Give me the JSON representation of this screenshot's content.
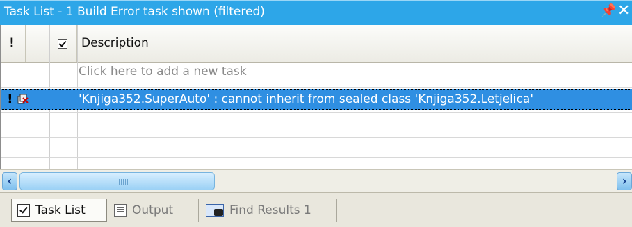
{
  "window": {
    "title": "Task List - 1 Build Error task shown (filtered)",
    "pin_glyph": "p",
    "close_glyph": "×"
  },
  "columns": {
    "priority": "!",
    "description": "Description"
  },
  "new_task_placeholder": "Click here to add a new task",
  "tasks": [
    {
      "priority": "!",
      "icon": "build-error-icon",
      "description": "'Knjiga352.SuperAuto' : cannot inherit from sealed class 'Knjiga352.Letjelica'"
    }
  ],
  "scroll": {
    "left_glyph": "‹",
    "right_glyph": "›"
  },
  "tabs": [
    {
      "label": "Task List",
      "icon": "task-list-icon",
      "active": true
    },
    {
      "label": "Output",
      "icon": "output-icon",
      "active": false
    },
    {
      "label": "Find Results 1",
      "icon": "find-results-icon",
      "active": false
    }
  ],
  "colors": {
    "title_bar": "#2da6e8",
    "selection": "#2f8fe2"
  }
}
